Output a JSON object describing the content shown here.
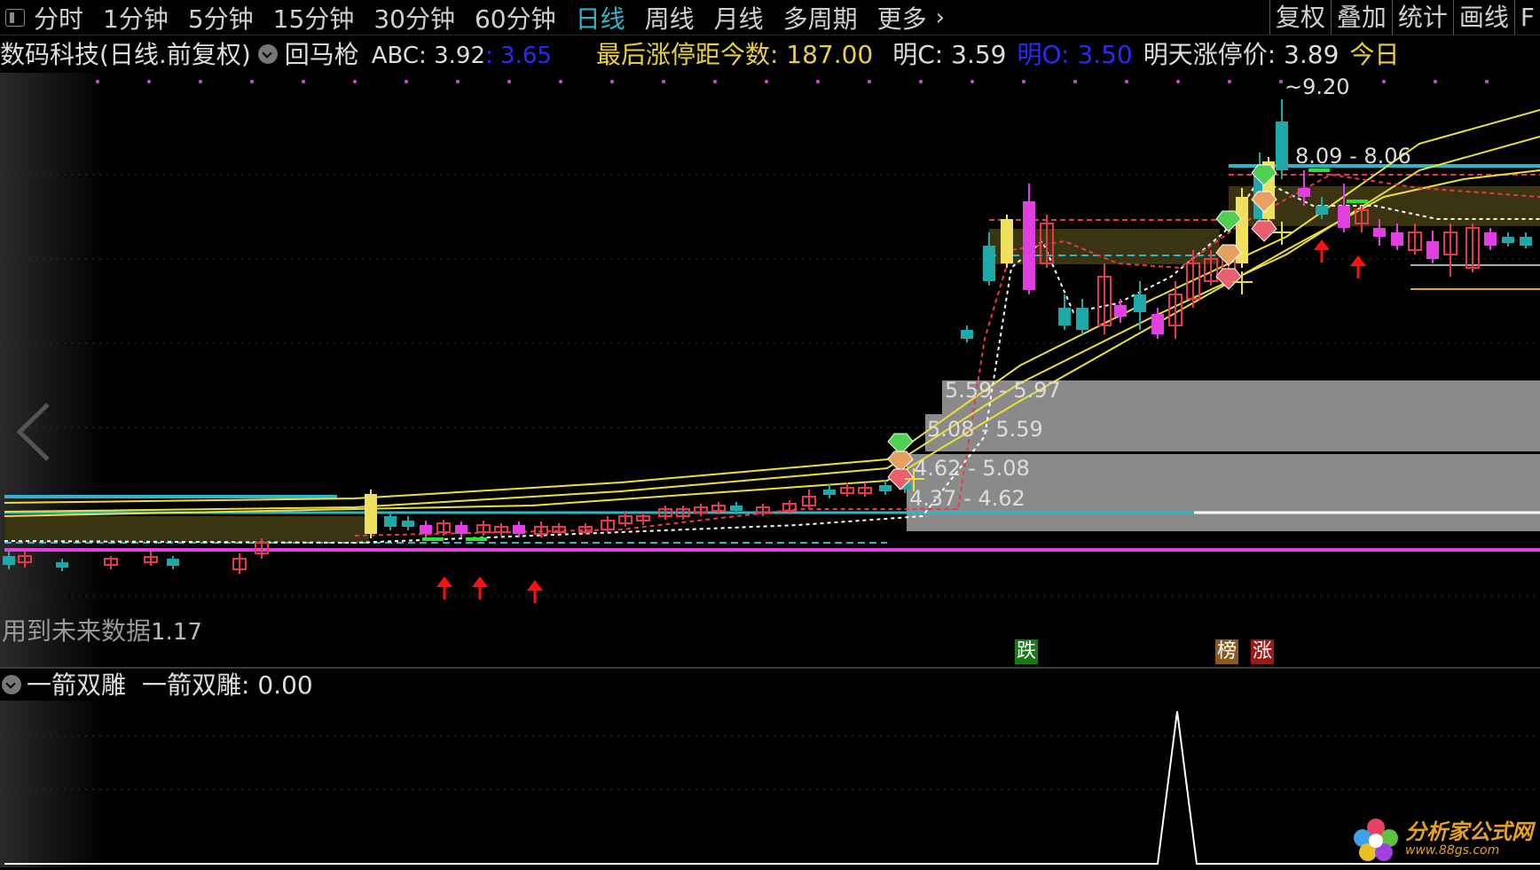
{
  "toolbar": {
    "timeframes": [
      "分时",
      "1分钟",
      "5分钟",
      "15分钟",
      "30分钟",
      "60分钟",
      "日线",
      "周线",
      "月线",
      "多周期",
      "更多"
    ],
    "active": "日线",
    "right_tools": [
      "复权",
      "叠加",
      "统计",
      "画线",
      "F"
    ]
  },
  "infobar": {
    "stock": "数码科技(日线.前复权)",
    "indicator": "回马枪",
    "abc_label": "ABC: 3.92",
    "abc_second": ": 3.65",
    "last_limit": "最后涨停距今数: 187.00",
    "next_c": "明C: 3.59",
    "next_o": "明O: 3.50",
    "limit_up": "明天涨停价: 3.89",
    "today": "今日"
  },
  "main_chart": {
    "price_labels": [
      "~9.20",
      "8.09 - 8.06",
      "5.59 - 5.97",
      "5.08 - 5.59",
      "4.62 - 5.08",
      "4.37 - 4.62"
    ],
    "bottom_note": "用到未来数据",
    "bottom_value": "1.17",
    "tags": [
      {
        "text": "跌",
        "color": "#1a7a1a"
      },
      {
        "text": "榜",
        "color": "#8a5a20"
      },
      {
        "text": "涨",
        "color": "#9a1a1a"
      }
    ]
  },
  "indicator_panel": {
    "name": "一箭双雕",
    "value_label": "一箭双雕: 0.00"
  },
  "watermark": {
    "title": "分析家公式网",
    "url": "www.88gs.com"
  },
  "colors": {
    "up": "#e8384a",
    "down": "#1fa8a8",
    "ma_yellow": "#e8e040",
    "cyan": "#2fb5c9",
    "magenta": "#e040e0"
  }
}
